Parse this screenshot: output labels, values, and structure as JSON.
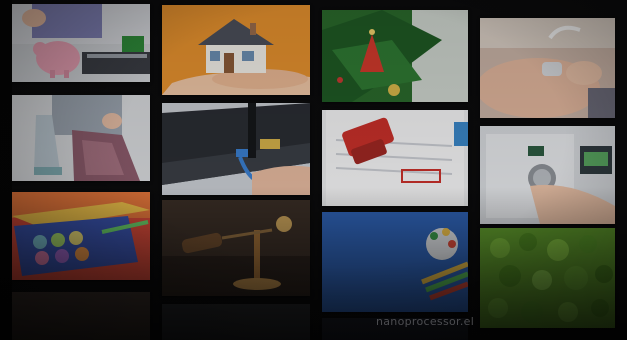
{
  "image": {
    "description_tiles": [
      {
        "name": "tile-piggy-bank"
      },
      {
        "name": "tile-house-in-hand"
      },
      {
        "name": "tile-christmas-tree"
      },
      {
        "name": "tile-ultrasound"
      },
      {
        "name": "tile-ironing"
      },
      {
        "name": "tile-router"
      },
      {
        "name": "tile-approved-stamp"
      },
      {
        "name": "tile-washing-machine"
      },
      {
        "name": "tile-paint-palette"
      },
      {
        "name": "tile-gavel"
      },
      {
        "name": "tile-colored-pencils"
      },
      {
        "name": "tile-moss"
      }
    ]
  },
  "colors": {
    "background": "#0b0b0c",
    "house_bg": "#e7922e",
    "moss": "#5f9a2c",
    "pencils_bg": "#2f63b7",
    "stamp_red": "#c8302a"
  },
  "watermark": {
    "text": "nanoprocessor.el"
  }
}
